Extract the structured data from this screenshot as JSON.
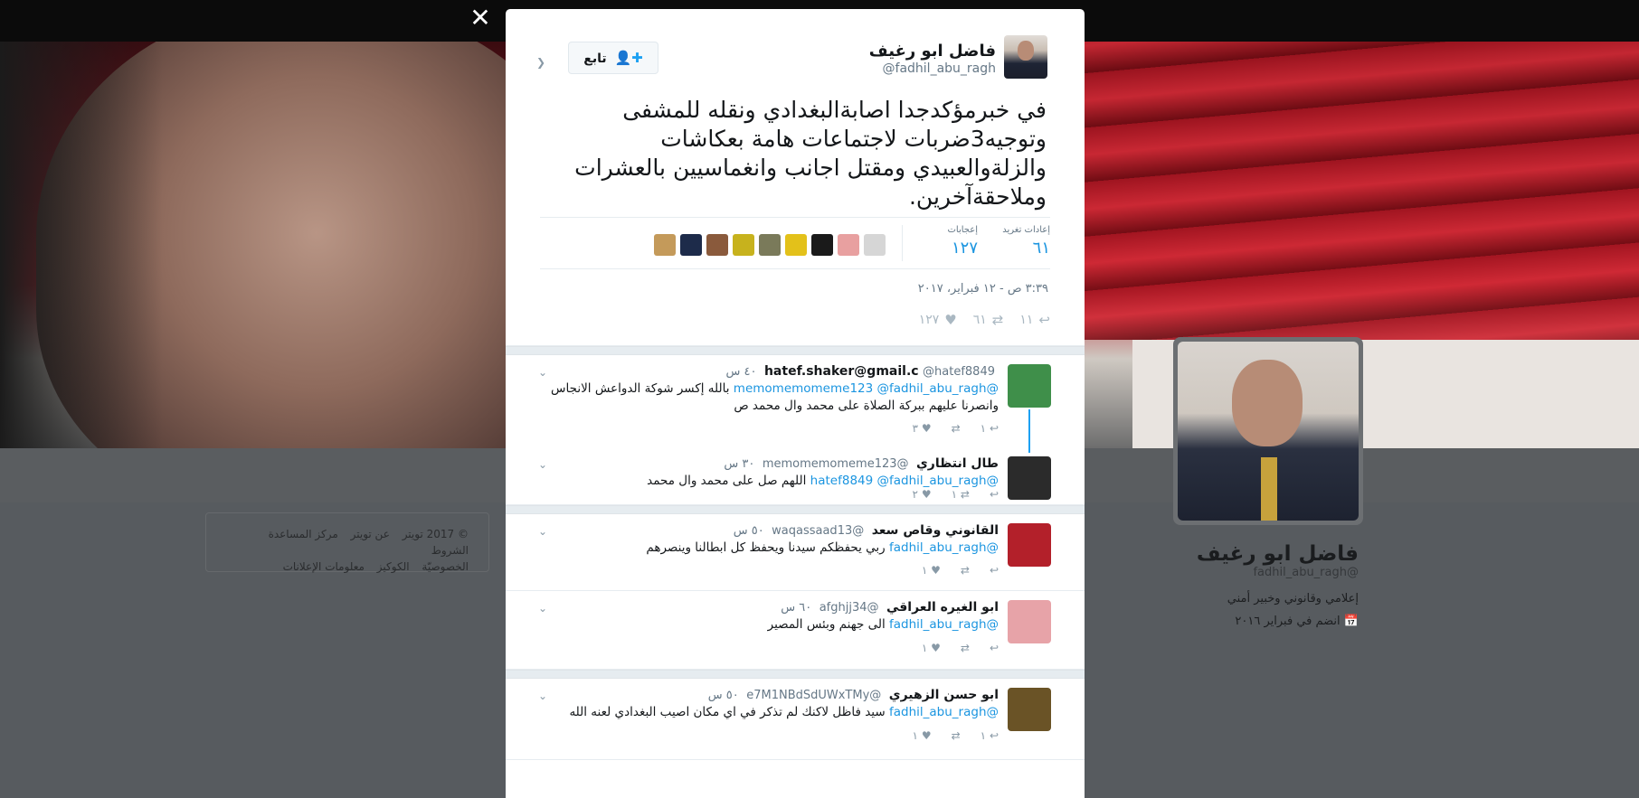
{
  "profile": {
    "name": "فاضل ابو رغيف",
    "handle": "@fadhil_abu_ragh",
    "bio": "إعلامي وقانوني وخبير أمني",
    "joined": "انضم في فبراير ٢٠١٦"
  },
  "footer": {
    "line1": [
      "© 2017 تويتر",
      "عن تويتر",
      "مركز المساعدة",
      "الشروط"
    ],
    "line2": [
      "الخصوصيّة",
      "الكوكيز",
      "معلومات الإعلانات"
    ]
  },
  "main_tweet": {
    "name": "فاضل ابو رغيف",
    "handle": "@fadhil_abu_ragh",
    "follow_label": "تابع",
    "text": "في خبرمؤكدجدا اصابةالبغدادي ونقله للمشفى وتوجيه3ضربات لاجتماعات هامة بعكاشات والزلةوالعبيدي ومقتل اجانب وانغماسيين بالعشرات وملاحقةآخرين.",
    "retweets_label": "إعادات تغريد",
    "retweets": "٦١",
    "likes_label": "إعجابات",
    "likes": "١٢٧",
    "timestamp": "٣:٣٩ ص - ١٢ فبراير، ٢٠١٧",
    "reply_count": "١١",
    "retweet_count": "٦١",
    "like_count": "١٢٧",
    "liker_colors": [
      "#c49a5a",
      "#1d2b4a",
      "#8a5a3c",
      "#c7b21d",
      "#7a7a5a",
      "#e3c11a",
      "#1a1a1a",
      "#e8a0a0",
      "#d6d6d6"
    ]
  },
  "replies": [
    {
      "name": "hatef.shaker@gmail.c",
      "handle": "@hatef8849",
      "time": "٤٠ س",
      "mentions": "@memomemomeme123 @fadhil_abu_ragh",
      "text": "بالله إكسر شوكة الدواعش الانجاس وانصرنا عليهم ببركة الصلاة على محمد وال محمد ص",
      "replies": "١",
      "retweets": "",
      "likes": "٣",
      "avatar_color": "#3f8f4a"
    },
    {
      "name": "طال انتظاري",
      "handle": "@memomemomeme123",
      "time": "٣٠ س",
      "mentions": "@hatef8849 @fadhil_abu_ragh",
      "text": "اللهم صل على محمد وال محمد",
      "replies": "",
      "retweets": "١",
      "likes": "٢",
      "avatar_color": "#2b2b2b"
    },
    {
      "name": "القانوني وقاص سعد",
      "handle": "@waqassaad13",
      "time": "٥٠ س",
      "mentions": "@fadhil_abu_ragh",
      "text": "ربي يحفظكم سيدنا ويحفظ كل ابطالنا وينصرهم",
      "replies": "",
      "retweets": "",
      "likes": "١",
      "avatar_color": "#b3202a"
    },
    {
      "name": "ابو الغيره العراقي",
      "handle": "@afghjj34",
      "time": "٦٠ س",
      "mentions": "@fadhil_abu_ragh",
      "text": "الى جهنم وبئس المصير",
      "replies": "",
      "retweets": "",
      "likes": "١",
      "avatar_color": "#e7a3a8"
    },
    {
      "name": "ابو حسن الزهيري",
      "handle": "@e7M1NBdSdUWxTMy",
      "time": "٥٠ س",
      "mentions": "@fadhil_abu_ragh",
      "text": "سيد فاظل لاكنك لم تذكر في اي مكان اصيب البغدادي لعنه الله",
      "replies": "١",
      "retweets": "",
      "likes": "١",
      "avatar_color": "#6a5326"
    }
  ],
  "icons": {
    "close": "close-icon",
    "follow": "add-user-icon",
    "reply": "reply-icon",
    "retweet": "retweet-icon",
    "like": "heart-icon",
    "calendar": "calendar-icon",
    "caret": "chevron-down-icon"
  }
}
